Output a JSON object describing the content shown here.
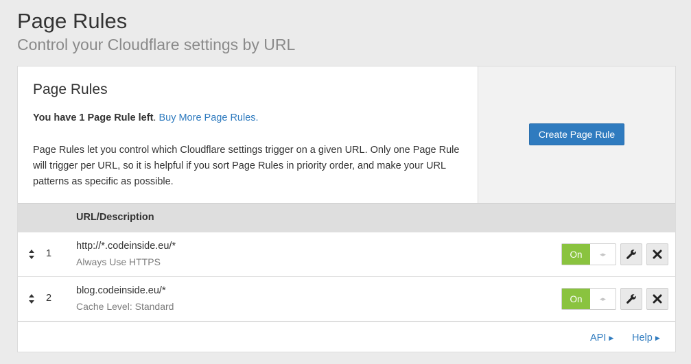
{
  "header": {
    "title": "Page Rules",
    "subtitle": "Control your Cloudflare settings by URL"
  },
  "card": {
    "heading": "Page Rules",
    "rules_left_bold": "You have 1 Page Rule left",
    "rules_left_sep": ". ",
    "buy_more_link": "Buy More Page Rules.",
    "description": "Page Rules let you control which Cloudflare settings trigger on a given URL. Only one Page Rule will trigger per URL, so it is helpful if you sort Page Rules in priority order, and make your URL patterns as specific as possible.",
    "create_button": "Create Page Rule"
  },
  "table": {
    "column_header": "URL/Description",
    "rows": [
      {
        "number": "1",
        "url": "http://*.codeinside.eu/*",
        "setting": "Always Use HTTPS",
        "toggle": "On"
      },
      {
        "number": "2",
        "url": "blog.codeinside.eu/*",
        "setting": "Cache Level: Standard",
        "toggle": "On"
      }
    ]
  },
  "footer": {
    "api_link": "API",
    "help_link": "Help"
  },
  "icons": {
    "drag": "sort-arrows-icon",
    "edit": "wrench-icon",
    "delete": "close-icon",
    "link_caret": "caret-right-icon"
  },
  "colors": {
    "accent": "#2f7bbf",
    "toggle_on": "#8ac33f"
  }
}
